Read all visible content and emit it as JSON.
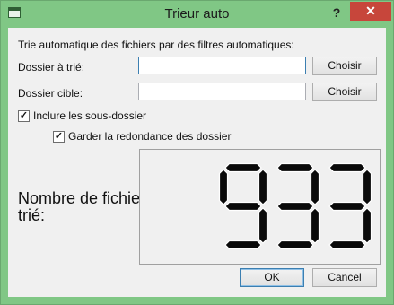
{
  "window": {
    "title": "Trieur auto",
    "help_label": "?",
    "close_label": "✕",
    "app_icon": "window-icon"
  },
  "description": "Trie automatique des fichiers par des filtres automatiques:",
  "source": {
    "label": "Dossier à trié:",
    "value": "",
    "button": "Choisir"
  },
  "target": {
    "label": "Dossier cible:",
    "value": "",
    "button": "Choisir"
  },
  "options": {
    "include_sub": {
      "label": "Inclure les sous-dossier",
      "checked": true
    },
    "keep_redundancy": {
      "label": "Garder la redondance des dossier",
      "checked": true
    }
  },
  "counter": {
    "label_line1": "Nombre de fichier",
    "label_line2": "trié:",
    "value": "933"
  },
  "buttons": {
    "ok": "OK",
    "cancel": "Cancel"
  },
  "colors": {
    "frame": "#80c785",
    "close": "#c7463b",
    "accent": "#3c7fb1"
  }
}
